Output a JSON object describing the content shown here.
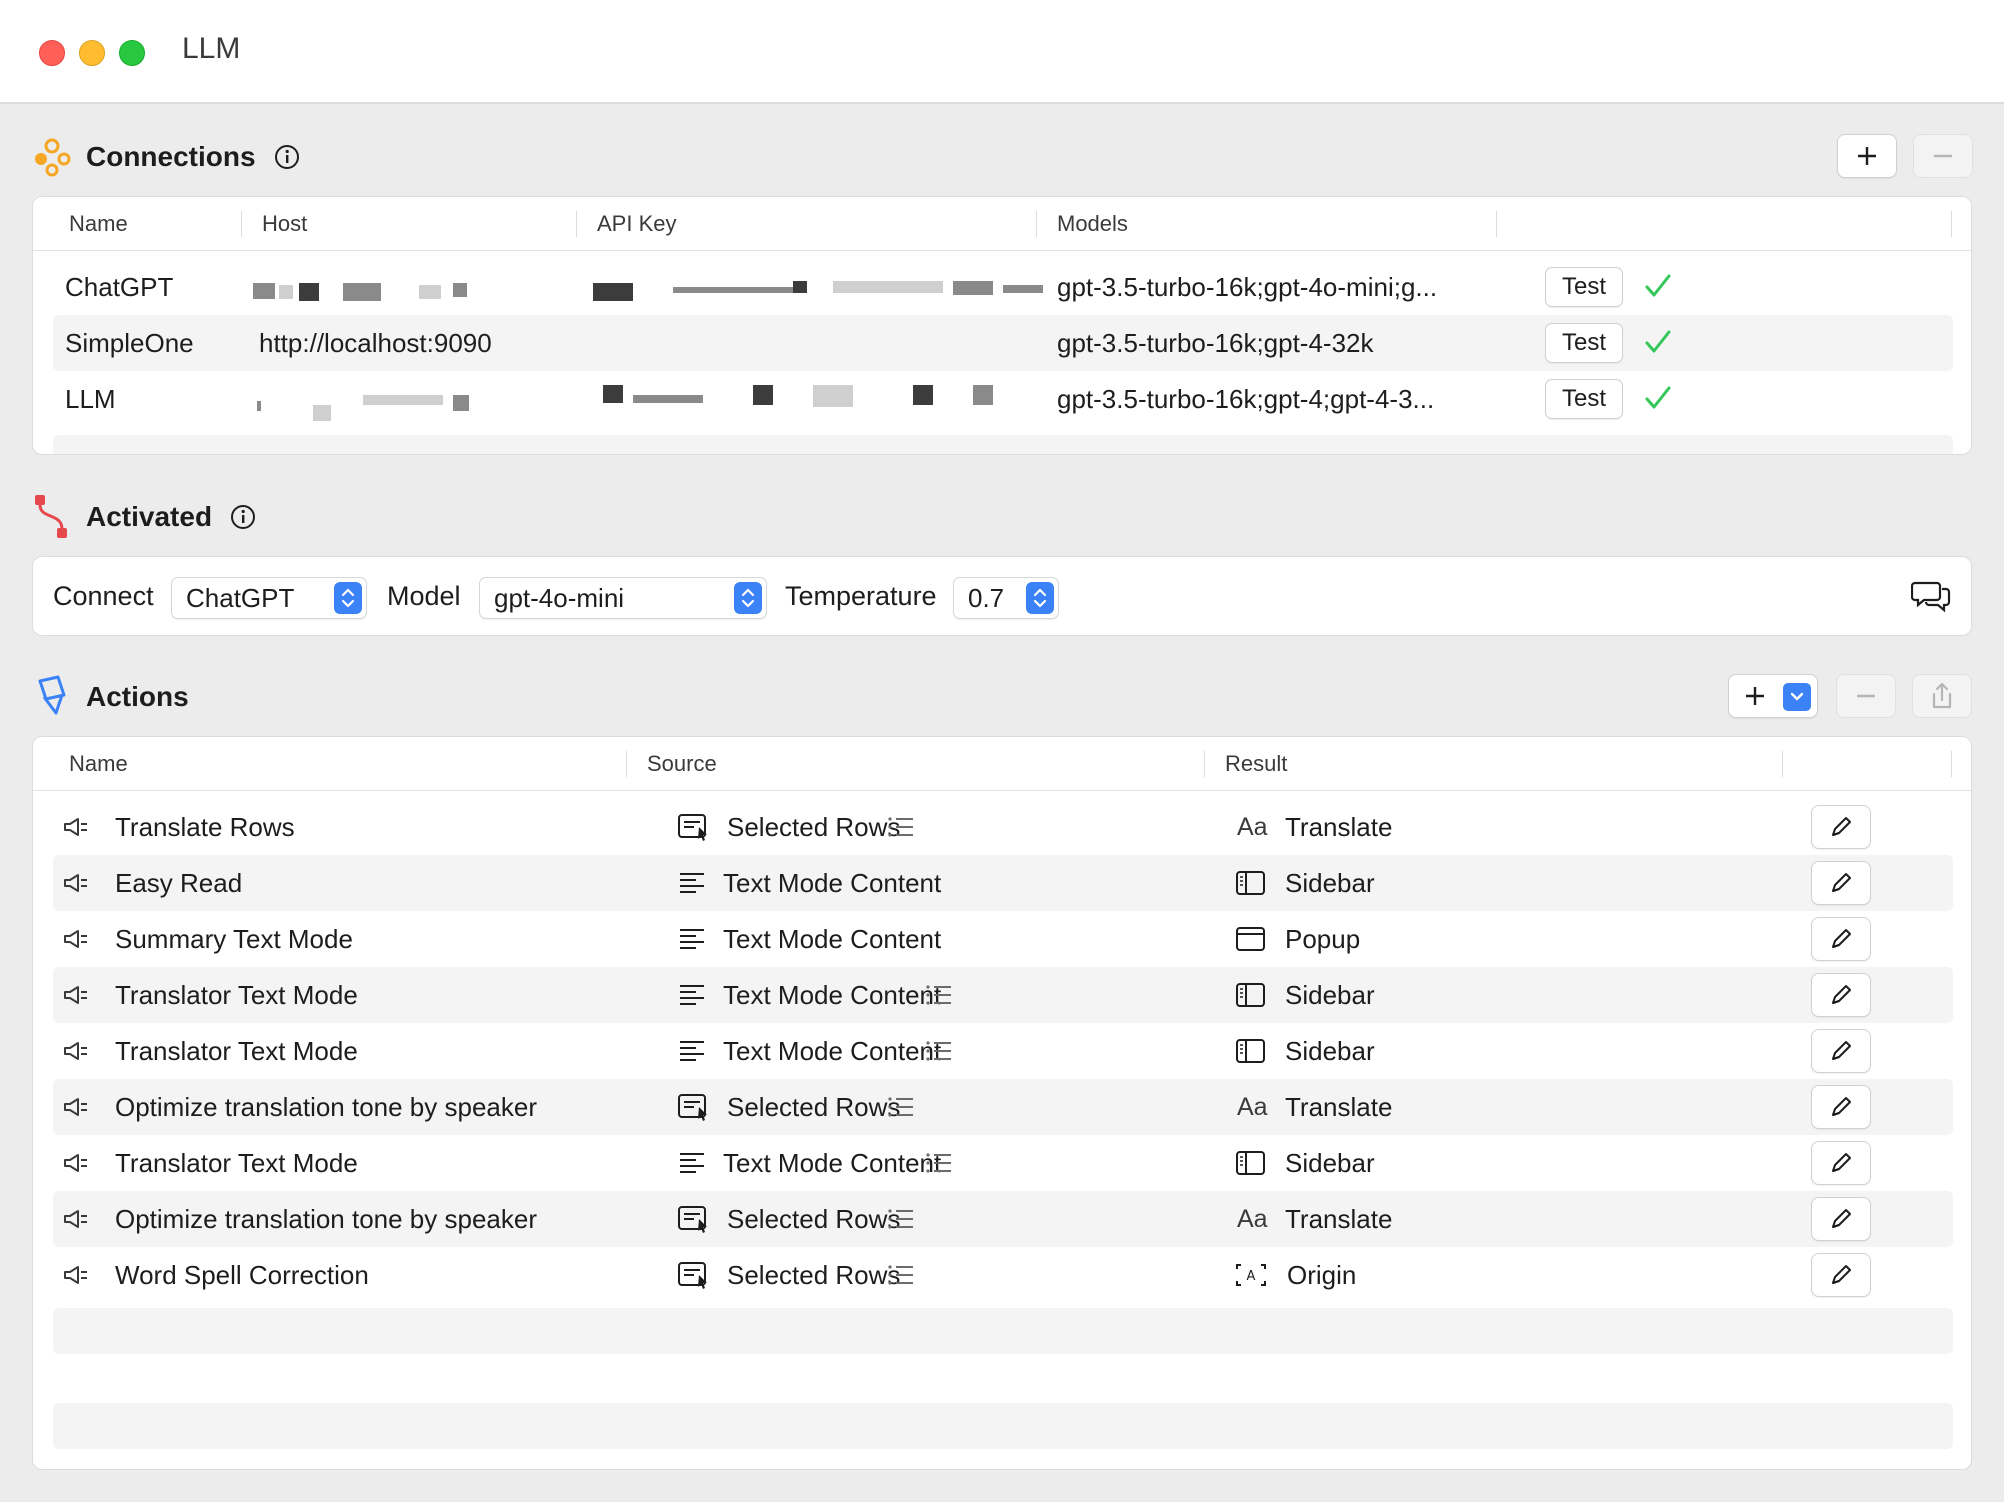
{
  "window": {
    "title": "LLM"
  },
  "connections": {
    "title": "Connections",
    "columns": [
      "Name",
      "Host",
      "API Key",
      "Models"
    ],
    "rows": [
      {
        "name": "ChatGPT",
        "host": "",
        "models": "gpt-3.5-turbo-16k;gpt-4o-mini;g...",
        "test_label": "Test"
      },
      {
        "name": "SimpleOne",
        "host": "http://localhost:9090",
        "models": "gpt-3.5-turbo-16k;gpt-4-32k",
        "test_label": "Test"
      },
      {
        "name": "LLM",
        "host": "",
        "models": "gpt-3.5-turbo-16k;gpt-4;gpt-4-3...",
        "test_label": "Test"
      }
    ]
  },
  "activated": {
    "title": "Activated",
    "connect_label": "Connect",
    "connect_value": "ChatGPT",
    "model_label": "Model",
    "model_value": "gpt-4o-mini",
    "temperature_label": "Temperature",
    "temperature_value": "0.7"
  },
  "actions": {
    "title": "Actions",
    "columns": [
      "Name",
      "Source",
      "Result"
    ],
    "rows": [
      {
        "name": "Translate Rows",
        "source": "Selected Rows",
        "source_icon": "selected-rows-icon",
        "list": true,
        "result": "Translate",
        "result_icon": "aa-icon"
      },
      {
        "name": "Easy Read",
        "source": "Text Mode Content",
        "source_icon": "text-lines-icon",
        "list": false,
        "result": "Sidebar",
        "result_icon": "sidebar-icon"
      },
      {
        "name": "Summary Text Mode",
        "source": "Text Mode Content",
        "source_icon": "text-lines-icon",
        "list": false,
        "result": "Popup",
        "result_icon": "popup-icon"
      },
      {
        "name": "Translator Text Mode",
        "source": "Text Mode Content",
        "source_icon": "text-lines-icon",
        "list": true,
        "result": "Sidebar",
        "result_icon": "sidebar-icon"
      },
      {
        "name": "Translator Text Mode",
        "source": "Text Mode Content",
        "source_icon": "text-lines-icon",
        "list": true,
        "result": "Sidebar",
        "result_icon": "sidebar-icon"
      },
      {
        "name": "Optimize translation tone by speaker",
        "source": "Selected Rows",
        "source_icon": "selected-rows-icon",
        "list": true,
        "result": "Translate",
        "result_icon": "aa-icon"
      },
      {
        "name": "Translator Text Mode",
        "source": "Text Mode Content",
        "source_icon": "text-lines-icon",
        "list": true,
        "result": "Sidebar",
        "result_icon": "sidebar-icon"
      },
      {
        "name": "Optimize translation tone by speaker",
        "source": "Selected Rows",
        "source_icon": "selected-rows-icon",
        "list": true,
        "result": "Translate",
        "result_icon": "aa-icon"
      },
      {
        "name": "Word Spell Correction",
        "source": "Selected Rows",
        "source_icon": "selected-rows-icon",
        "list": true,
        "result": "Origin",
        "result_icon": "origin-icon"
      }
    ],
    "result_aa_glyph": "Aa"
  },
  "colors": {
    "accent": "#3b82f6",
    "check": "#34c759",
    "connections_icon": "#f5a623",
    "activated_icon": "#e5484d",
    "actions_icon": "#3b82f6"
  }
}
